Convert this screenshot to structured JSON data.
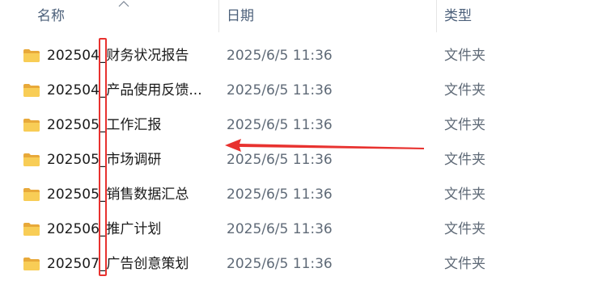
{
  "columns": {
    "name": "名称",
    "date": "日期",
    "type": "类型"
  },
  "sort": {
    "column": "name",
    "direction": "ascending",
    "icon": "chevron-up-icon"
  },
  "files": [
    {
      "name": "202504_财务状况报告",
      "date": "2025/6/5 11:36",
      "type": "文件夹",
      "icon": "folder-icon"
    },
    {
      "name": "202504_产品使用反馈...",
      "date": "2025/6/5 11:36",
      "type": "文件夹",
      "icon": "folder-icon"
    },
    {
      "name": "202505_工作汇报",
      "date": "2025/6/5 11:36",
      "type": "文件夹",
      "icon": "folder-icon"
    },
    {
      "name": "202505_市场调研",
      "date": "2025/6/5 11:36",
      "type": "文件夹",
      "icon": "folder-icon"
    },
    {
      "name": "202505_销售数据汇总",
      "date": "2025/6/5 11:36",
      "type": "文件夹",
      "icon": "folder-icon"
    },
    {
      "name": "202506_推广计划",
      "date": "2025/6/5 11:36",
      "type": "文件夹",
      "icon": "folder-icon"
    },
    {
      "name": "202507_广告创意策划",
      "date": "2025/6/5 11:36",
      "type": "文件夹",
      "icon": "folder-icon"
    }
  ],
  "annotations": {
    "highlight_color": "#e8322f"
  }
}
